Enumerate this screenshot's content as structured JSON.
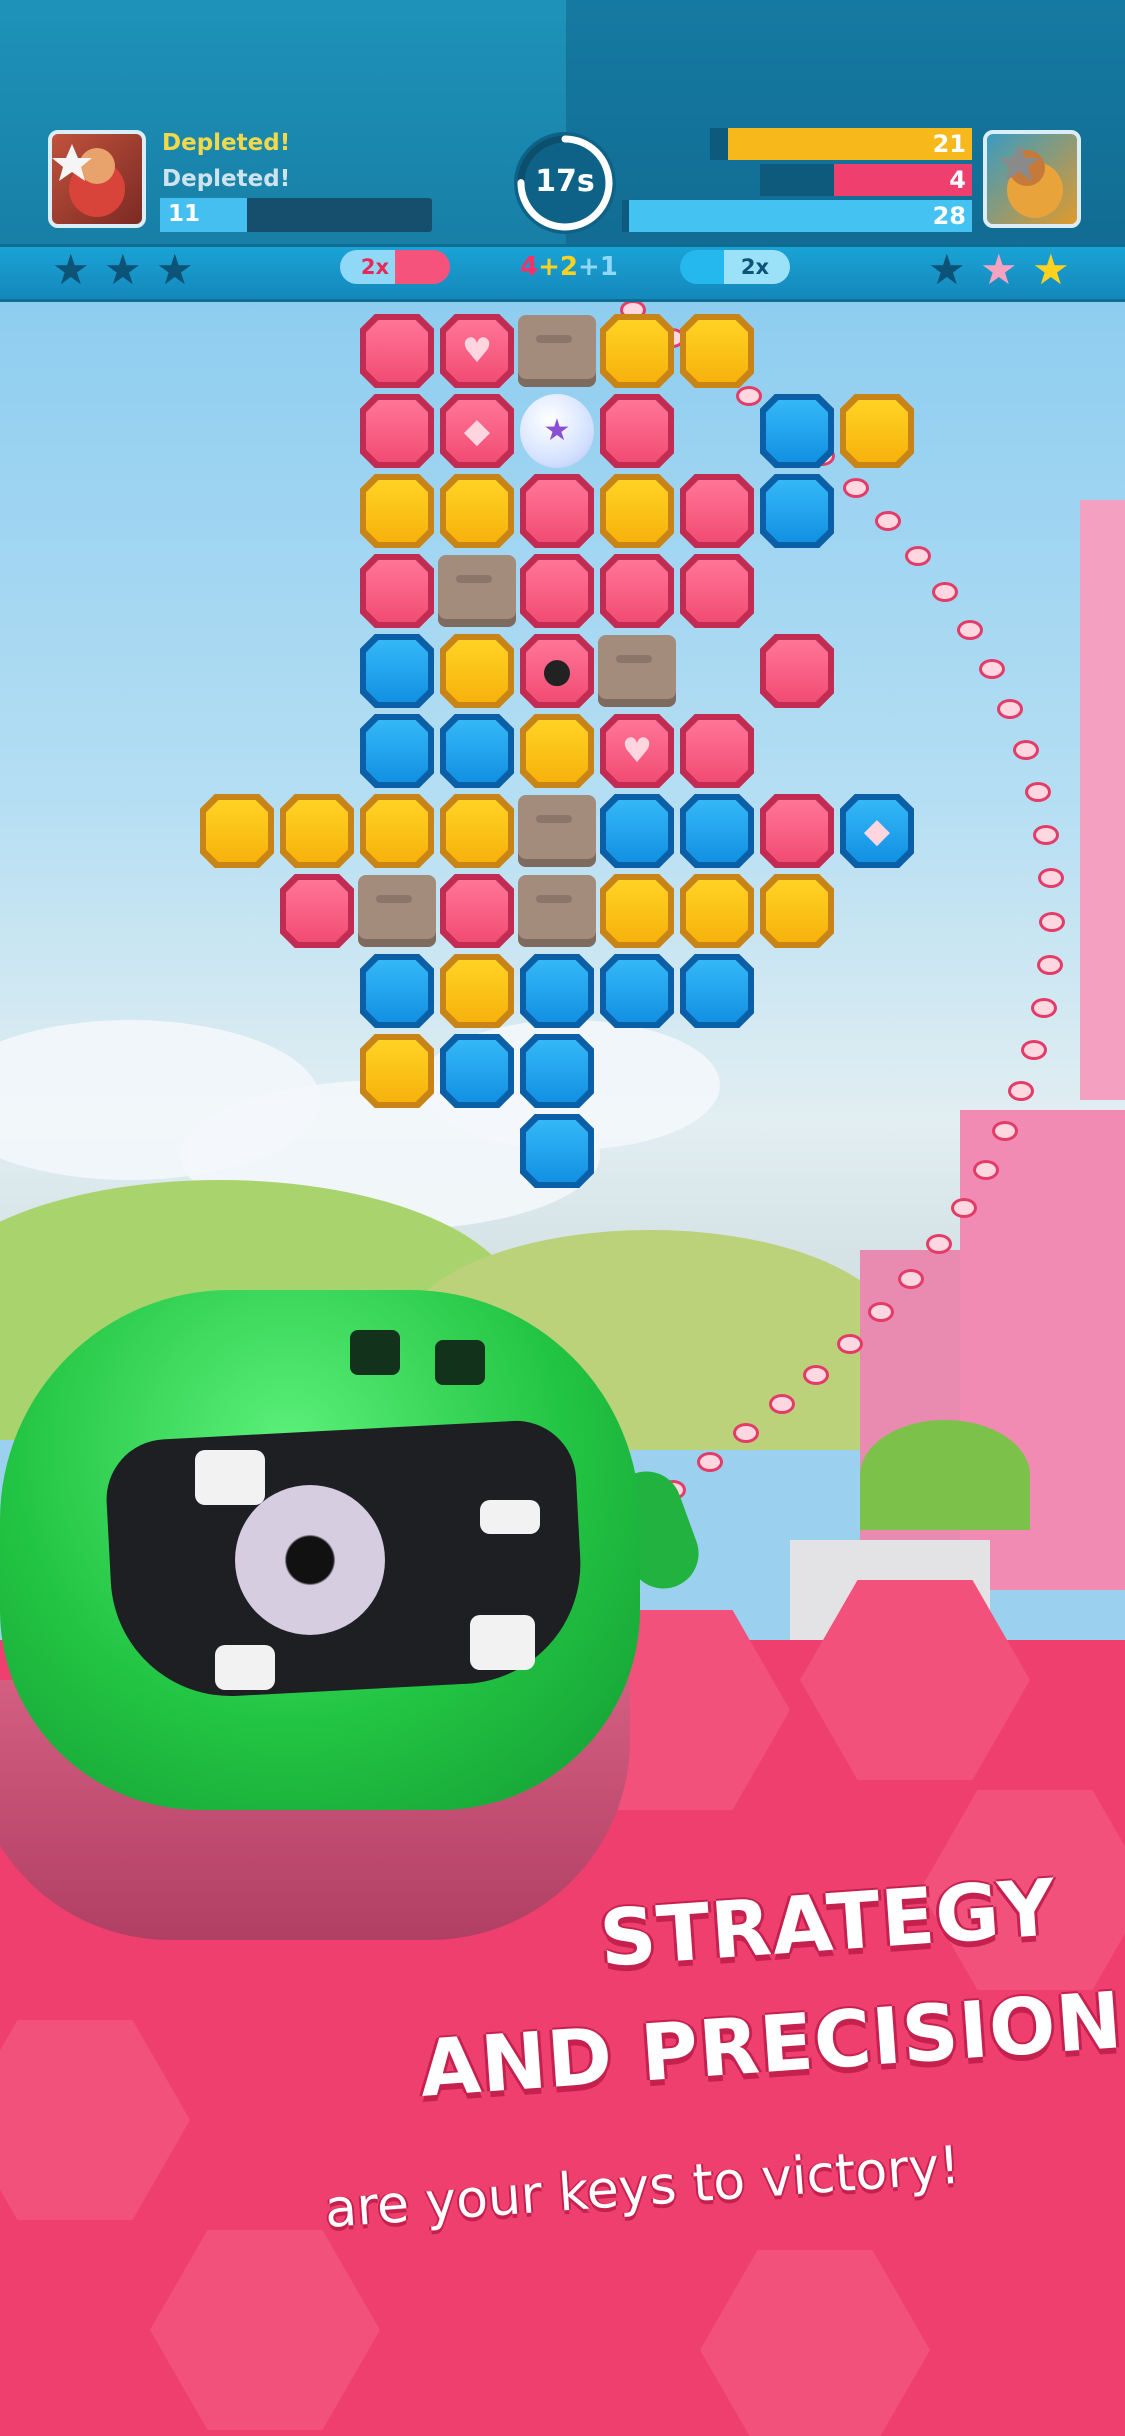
{
  "hud": {
    "left": {
      "status1": "Depleted!",
      "status2": "Depleted!",
      "count": "11",
      "bar_fill": 0.32
    },
    "timer": "17s",
    "timer_fill": 0.75,
    "right": {
      "values": [
        "21",
        "4",
        "28"
      ],
      "bar_fills": [
        0.93,
        0.65,
        0.98
      ],
      "bar_colors": [
        "#f6b81a",
        "#ef3f6f",
        "#44c3f3"
      ]
    },
    "left_stars": [
      "★",
      "★",
      "★"
    ],
    "right_stars": [
      "★",
      "★",
      "★"
    ],
    "multiplier_left": "2x",
    "multiplier_right": "2x",
    "combo": {
      "a": "4",
      "plus1": "+",
      "b": "2",
      "plus2": "+",
      "c": "1"
    }
  },
  "board": {
    "rows": [
      "phRyy....",
      "pfsp.by..",
      "yypypb...",
      "pRppp....",
      "bytR.p...",
      "bbyhp....",
      "yyyyRbbpf",
      "pRpRyyy..",
      "bybbb....",
      "ybb......",
      "b........"
    ]
  },
  "caption": {
    "line1": "STRATEGY",
    "line2": "AND PRECISION",
    "line3": "are your keys to victory!"
  }
}
